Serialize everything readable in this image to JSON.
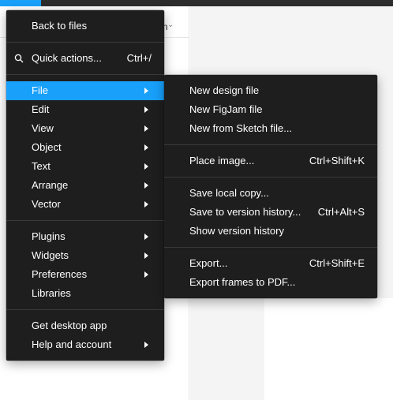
{
  "background": {
    "page_selector_tail": "n",
    "colors": {
      "accent": "#18a0fb",
      "menu_bg": "#1e1e1e",
      "canvas_bg": "#f4f4f4"
    }
  },
  "main_menu": {
    "back_to_files": "Back to files",
    "quick_actions": {
      "label": "Quick actions...",
      "shortcut": "Ctrl+/",
      "icon": "search-icon"
    },
    "file": "File",
    "edit": "Edit",
    "view": "View",
    "object": "Object",
    "text": "Text",
    "arrange": "Arrange",
    "vector": "Vector",
    "plugins": "Plugins",
    "widgets": "Widgets",
    "preferences": "Preferences",
    "libraries": "Libraries",
    "get_desktop_app": "Get desktop app",
    "help_and_account": "Help and account"
  },
  "file_submenu": {
    "new_design_file": "New design file",
    "new_figjam_file": "New FigJam file",
    "new_from_sketch": "New from Sketch file...",
    "place_image": {
      "label": "Place image...",
      "shortcut": "Ctrl+Shift+K"
    },
    "save_local_copy": "Save local copy...",
    "save_to_version_history": {
      "label": "Save to version history...",
      "shortcut": "Ctrl+Alt+S"
    },
    "show_version_history": "Show version history",
    "export": {
      "label": "Export...",
      "shortcut": "Ctrl+Shift+E"
    },
    "export_frames_pdf": "Export frames to PDF..."
  }
}
